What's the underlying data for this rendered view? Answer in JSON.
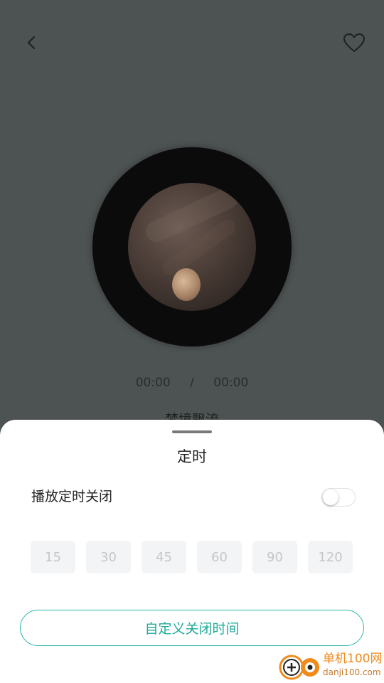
{
  "player": {
    "current_time": "00:00",
    "time_separator": "/",
    "total_time": "00:00",
    "song_title": "梦境飘流"
  },
  "icons": {
    "back": "chevron-left-icon",
    "favorite": "heart-outline-icon"
  },
  "timer_sheet": {
    "title": "定时",
    "toggle_label": "播放定时关闭",
    "toggle_on": false,
    "presets": [
      "15",
      "30",
      "45",
      "60",
      "90",
      "120"
    ],
    "custom_button_label": "自定义关闭时间"
  },
  "watermark": {
    "brand": "单机100网",
    "url": "danji100.com"
  },
  "colors": {
    "overlay_bg": "#4d5253",
    "accent": "#2bb5a8",
    "preset_bg": "#f3f4f6",
    "preset_text": "#c4c6c9",
    "watermark": "#f08a1c"
  }
}
